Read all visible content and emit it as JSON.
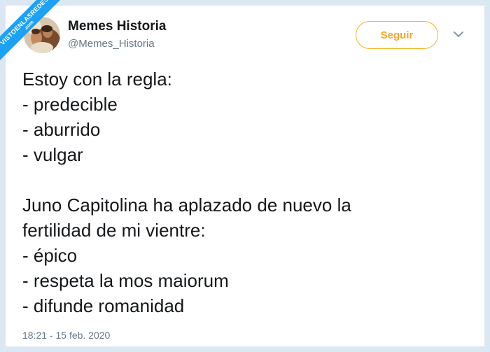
{
  "watermark": {
    "text": "VISTOENLASREDES",
    "suffix": ".com"
  },
  "user": {
    "name": "Memes Historia",
    "handle": "@Memes_Historia"
  },
  "actions": {
    "follow_label": "Seguir"
  },
  "tweet": {
    "lines_1": [
      "Estoy con la regla:",
      "- predecible",
      "- aburrido",
      "- vulgar"
    ],
    "lines_2": [
      "Juno Capitolina ha aplazado de nuevo la",
      "fertilidad de mi vientre:",
      "- épico",
      "- respeta la mos maiorum",
      "- difunde romanidad"
    ]
  },
  "timestamp": "18:21 - 15 feb. 2020",
  "colors": {
    "accent": "#f5a623",
    "frame": "#dbe7f2",
    "text": "#14171a",
    "muted": "#657786",
    "watermark": "#1da1f2"
  },
  "icons": {
    "menu": "chevron-down-icon",
    "avatar": "profile-avatar"
  }
}
